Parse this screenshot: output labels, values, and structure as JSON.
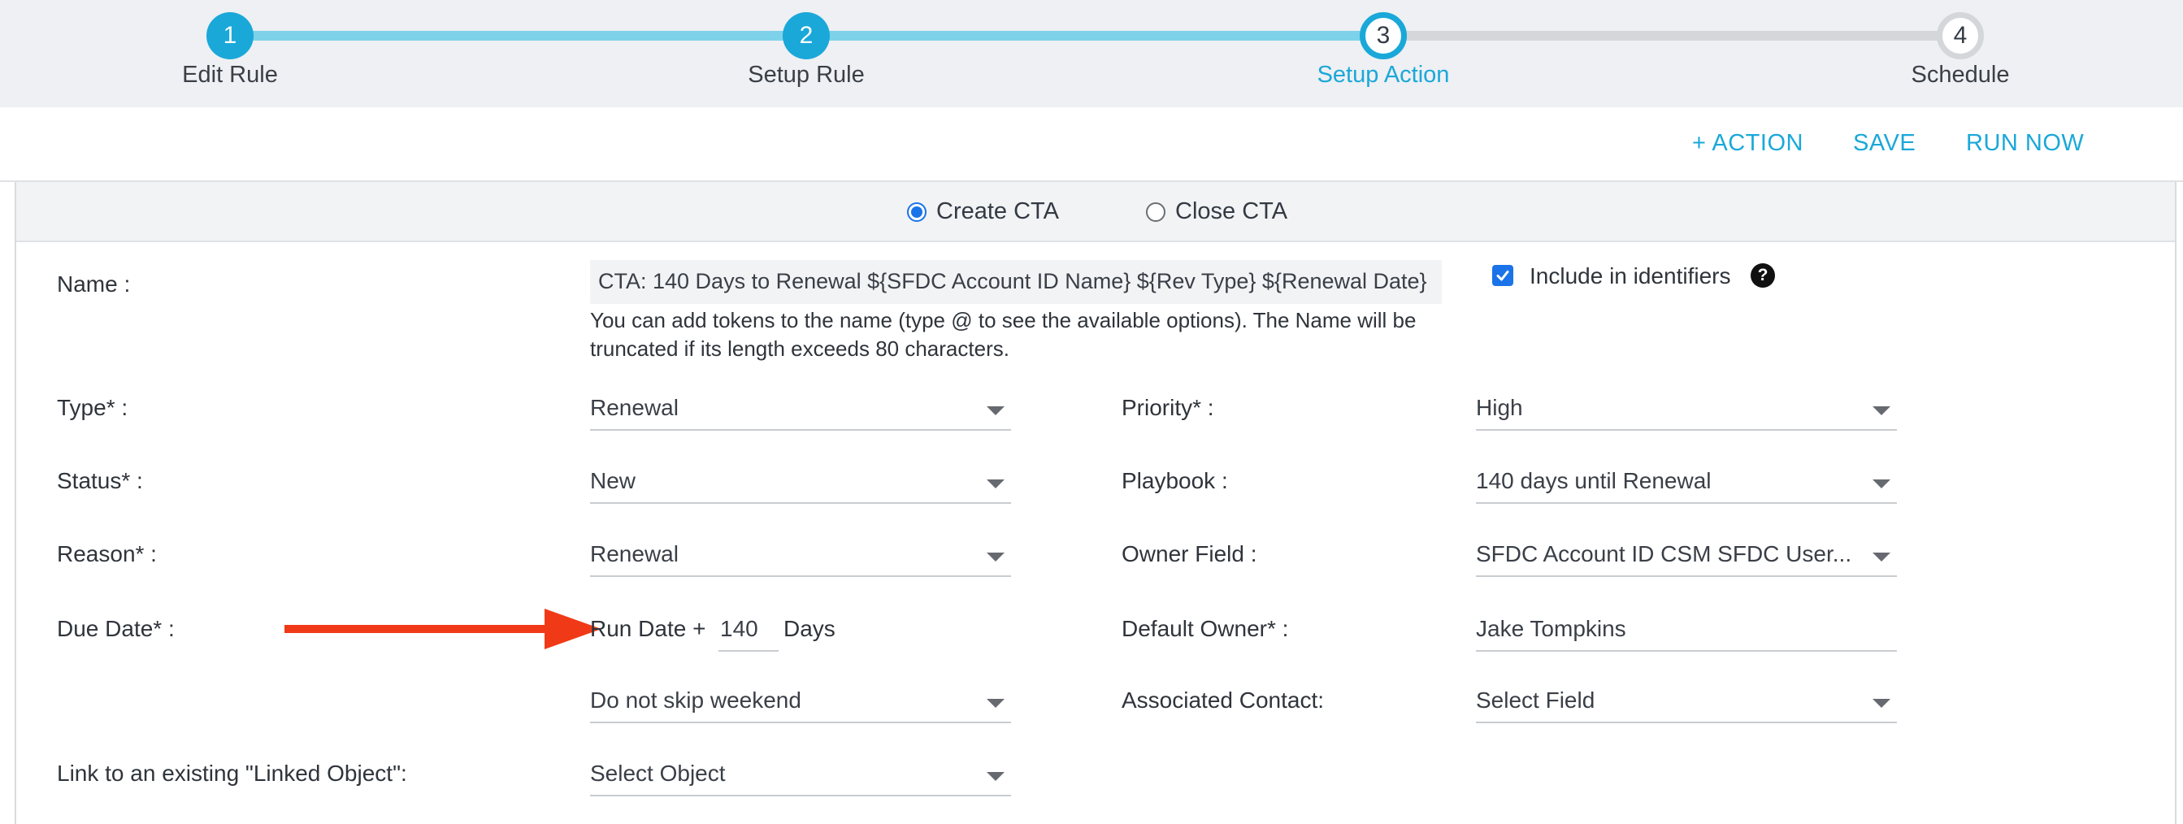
{
  "stepper": {
    "steps": [
      {
        "number": "1",
        "label": "Edit Rule",
        "state": "done"
      },
      {
        "number": "2",
        "label": "Setup Rule",
        "state": "done"
      },
      {
        "number": "3",
        "label": "Setup Action",
        "state": "current"
      },
      {
        "number": "4",
        "label": "Schedule",
        "state": "todo"
      }
    ]
  },
  "actions": {
    "add_action": "+ ACTION",
    "save": "SAVE",
    "run_now": "RUN NOW"
  },
  "mode": {
    "create_cta": "Create CTA",
    "close_cta": "Close CTA",
    "selected": "Create CTA"
  },
  "form": {
    "name": {
      "label": "Name :",
      "value": "CTA: 140 Days to Renewal ${SFDC Account ID Name} ${Rev Type} ${Renewal Date}",
      "help": "You can add tokens to the name (type @ to see the available options). The Name will be truncated if its length exceeds 80 characters."
    },
    "include_identifiers": {
      "label": "Include in identifiers",
      "checked": true,
      "help_icon": "question-circle-icon"
    },
    "type": {
      "label": "Type* :",
      "value": "Renewal"
    },
    "status": {
      "label": "Status* :",
      "value": "New"
    },
    "reason": {
      "label": "Reason* :",
      "value": "Renewal"
    },
    "due_date": {
      "label": "Due Date* :",
      "prefix": "Run Date +",
      "days": "140",
      "suffix": "Days"
    },
    "skip_weekend": {
      "value": "Do not skip weekend"
    },
    "linked_object": {
      "label": "Link to an existing \"Linked Object\":",
      "value": "Select Object"
    },
    "priority": {
      "label": "Priority* :",
      "value": "High"
    },
    "playbook": {
      "label": "Playbook :",
      "value": "140 days until Renewal"
    },
    "owner_field": {
      "label": "Owner Field :",
      "value": "SFDC Account ID CSM SFDC User..."
    },
    "default_owner": {
      "label": "Default Owner* :",
      "value": "Jake Tompkins"
    },
    "associated_contact": {
      "label": "Associated Contact:",
      "value": "Select Field"
    }
  },
  "colors": {
    "accent": "#1aa8d9",
    "arrow": "#f03a17",
    "checkbox": "#1a73e8"
  }
}
